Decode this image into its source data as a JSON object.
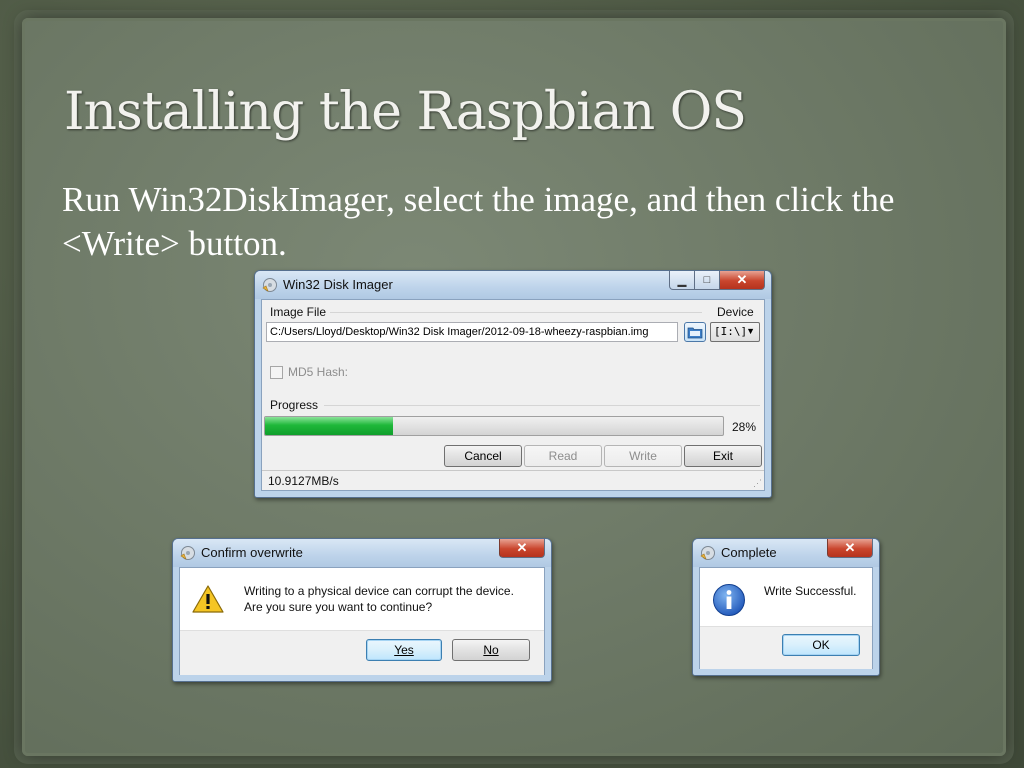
{
  "slide": {
    "title": "Installing the Raspbian OS",
    "body": "Run Win32DiskImager, select the image, and then click the <Write> button."
  },
  "disk_imager": {
    "title": "Win32 Disk Imager",
    "image_file_label": "Image File",
    "device_label": "Device",
    "image_path": "C:/Users/Lloyd/Desktop/Win32 Disk Imager/2012-09-18-wheezy-raspbian.img",
    "device_value": "[I:\\]",
    "md5_label": "MD5 Hash:",
    "progress_label": "Progress",
    "progress_percent": "28%",
    "progress_value": 0.28,
    "buttons": {
      "cancel": "Cancel",
      "read": "Read",
      "write": "Write",
      "exit": "Exit"
    },
    "status": "10.9127MB/s"
  },
  "confirm_dialog": {
    "title": "Confirm overwrite",
    "message_line1": "Writing to a physical device can corrupt the device.",
    "message_line2": "Are you sure you want to continue?",
    "yes_label": "Yes",
    "no_label": "No"
  },
  "complete_dialog": {
    "title": "Complete",
    "message": "Write Successful.",
    "ok_label": "OK"
  },
  "icons": {
    "app": "disk-imager-icon",
    "folder": "folder-browse-icon",
    "warning": "warning-icon",
    "info": "info-icon",
    "dropdown": "chevron-down-icon"
  },
  "colors": {
    "progress_fill": "#1fb83a",
    "close_button": "#c9452d",
    "title_text": "#f2f2ee"
  }
}
